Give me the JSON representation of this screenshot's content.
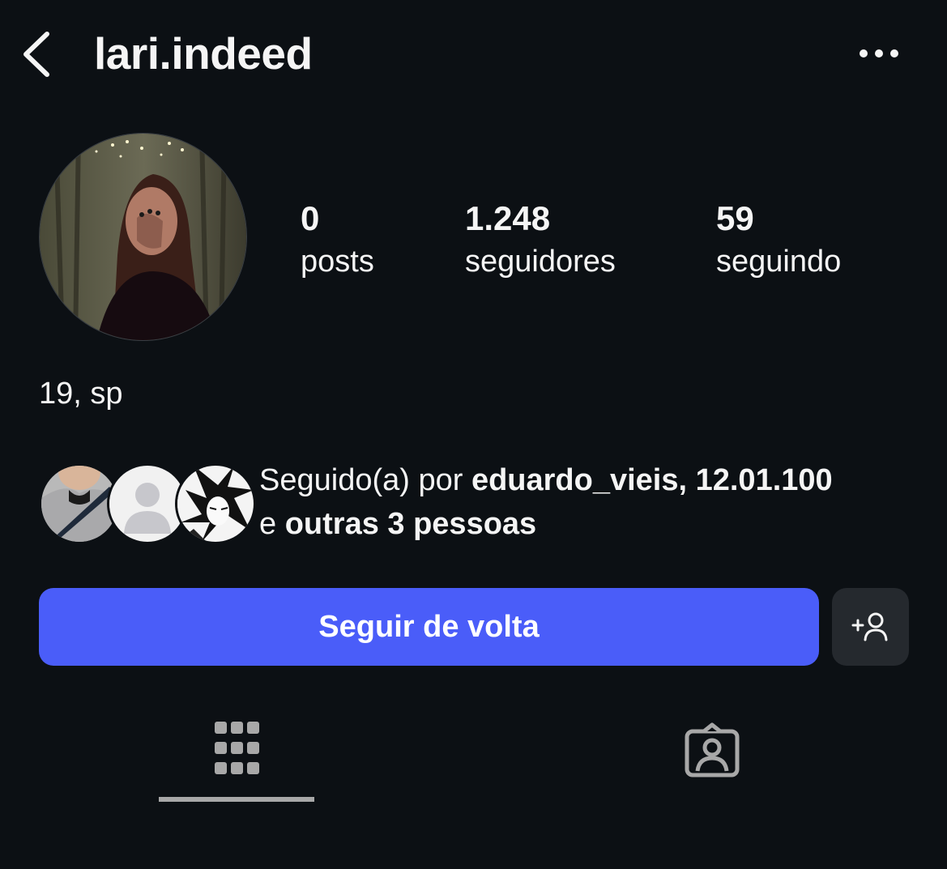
{
  "header": {
    "username": "lari.indeed",
    "back_icon": "chevron-left-icon",
    "more_icon": "more-horizontal-icon"
  },
  "profile": {
    "stats": [
      {
        "value": "0",
        "label": "posts"
      },
      {
        "value": "1.248",
        "label": "seguidores"
      },
      {
        "value": "59",
        "label": "seguindo"
      }
    ],
    "bio": "19, sp"
  },
  "followed_by": {
    "prefix": "Seguido(a) por ",
    "names": "eduardo_vieis, 12.01.100",
    "connector": "e ",
    "others": "outras 3 pessoas"
  },
  "actions": {
    "follow_back_label": "Seguir de volta",
    "suggest_icon": "add-person-icon"
  },
  "tabs": [
    {
      "icon": "grid-icon",
      "selected": true
    },
    {
      "icon": "tagged-person-icon",
      "selected": false
    }
  ],
  "colors": {
    "background": "#0c1014",
    "primary_button": "#4a5df9",
    "secondary_button": "#25292e",
    "text": "#f5f5f5",
    "muted": "#a8a8a8"
  }
}
